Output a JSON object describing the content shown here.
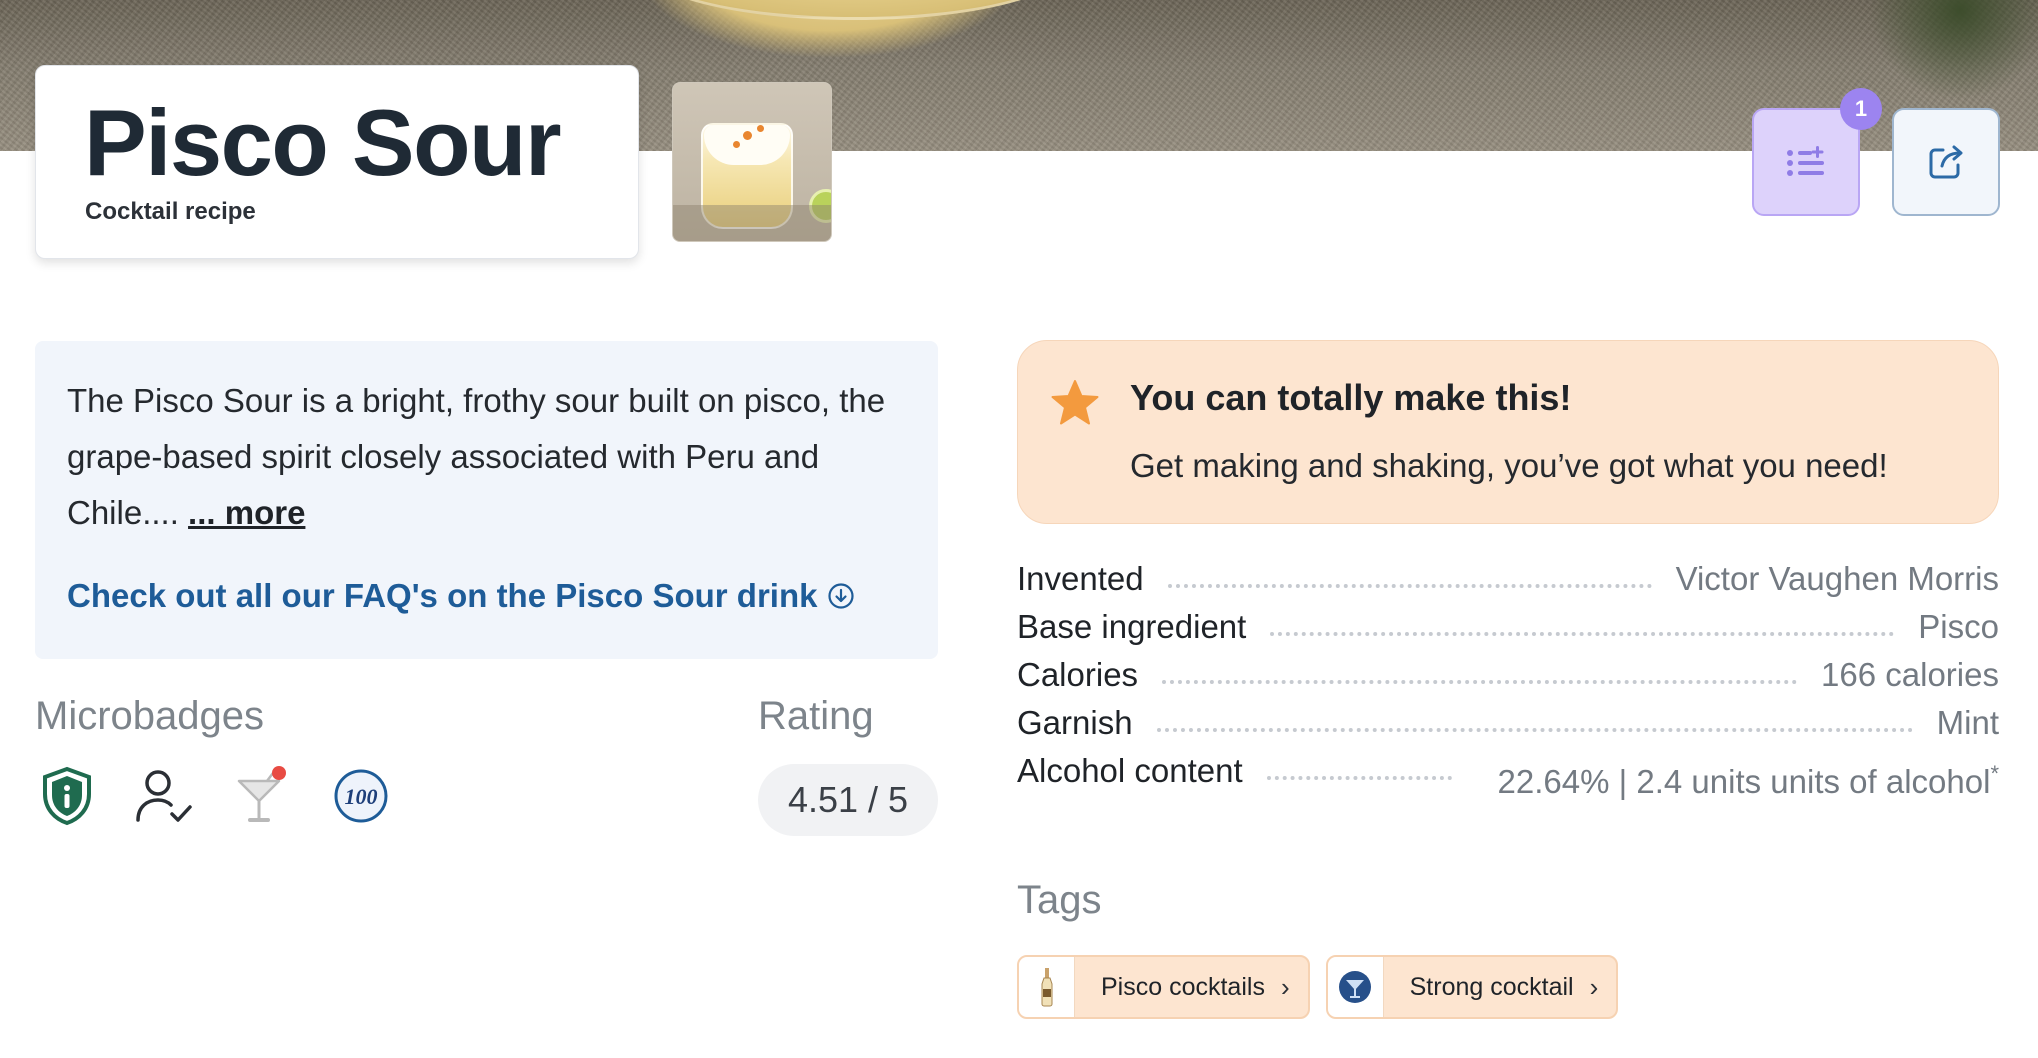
{
  "header": {
    "title": "Pisco Sour",
    "subtitle": "Cocktail recipe",
    "list_badge_count": "1"
  },
  "icons": {
    "list": "list-plus-icon",
    "share": "share-icon",
    "faq": "arrow-down-circle-icon",
    "cta": "star-icon"
  },
  "description": {
    "text": "The Pisco Sour is a bright, frothy sour built on pisco, the grape-based spirit closely associated with Peru and Chile.... ",
    "more_label": "... more",
    "faq_link": "Check out all our FAQ's on the Pisco Sour drink"
  },
  "microbadges": {
    "title": "Microbadges",
    "icons": [
      "shield-info-icon",
      "user-check-icon",
      "cocktail-glass-icon",
      "100-badge-icon"
    ]
  },
  "rating": {
    "title": "Rating",
    "value": "4.51 / 5"
  },
  "cta": {
    "title": "You can totally make this!",
    "subtitle": "Get making and shaking, you’ve got what you need!"
  },
  "facts": [
    {
      "label": "Invented",
      "value": "Victor Vaughen Morris"
    },
    {
      "label": "Base ingredient",
      "value": "Pisco"
    },
    {
      "label": "Calories",
      "value": "166 calories"
    },
    {
      "label": "Garnish",
      "value": "Mint"
    },
    {
      "label": "Alcohol content",
      "value": "22.64% | 2.4 units units of alcohol",
      "note": "*"
    }
  ],
  "tags": {
    "title": "Tags",
    "items": [
      {
        "label": "Pisco cocktails",
        "icon": "bottle-icon"
      },
      {
        "label": "Strong cocktail",
        "icon": "martini-glass-icon"
      }
    ]
  },
  "colors": {
    "accent_purple": "#9c84f0",
    "link_blue": "#1e5c98",
    "cta_background": "#fde5d0",
    "star_orange": "#f39a3e",
    "shield_green": "#1f6b4f"
  }
}
